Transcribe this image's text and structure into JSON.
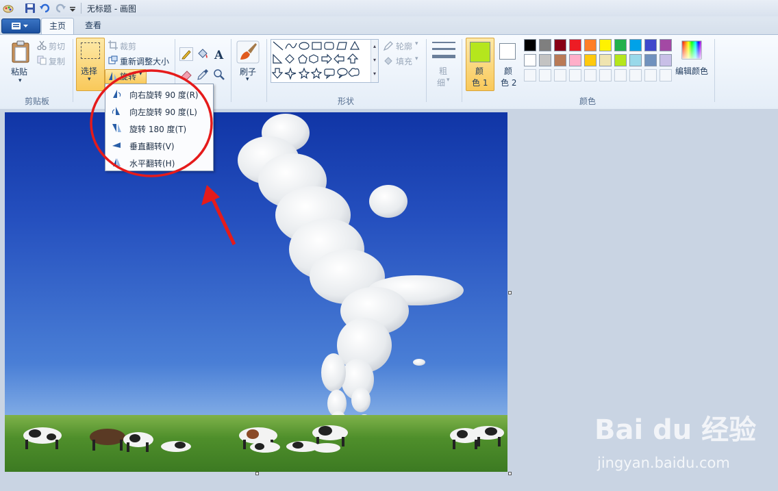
{
  "window": {
    "title": "无标题 - 画图"
  },
  "tabs": [
    {
      "label": "主页"
    },
    {
      "label": "查看"
    }
  ],
  "clipboard": {
    "paste": "粘贴",
    "cut": "剪切",
    "copy": "复制",
    "group": "剪贴板"
  },
  "image": {
    "select": "选择",
    "crop": "裁剪",
    "resize": "重新调整大小",
    "rotate": "旋转"
  },
  "tools": {
    "brush": "刷子"
  },
  "shapes": {
    "outline": "轮廓",
    "fill": "填充",
    "group": "形状"
  },
  "size": {
    "label_line1": "粗",
    "label_line2": "细"
  },
  "colors": {
    "color1_line1": "颜",
    "color1_line2": "色 1",
    "color2_line1": "颜",
    "color2_line2": "色 2",
    "edit": "编辑颜色",
    "group": "颜色",
    "color1_value": "#b5e61d",
    "color2_value": "#ffffff",
    "palette": [
      "#000000",
      "#7f7f7f",
      "#880015",
      "#ed1c24",
      "#ff7f27",
      "#fff200",
      "#22b14c",
      "#00a2e8",
      "#3f48cc",
      "#a349a4",
      "#ffffff",
      "#c3c3c3",
      "#b97a57",
      "#ffaec9",
      "#ffc90e",
      "#efe4b0",
      "#b5e61d",
      "#99d9ea",
      "#7092be",
      "#c8bfe7"
    ]
  },
  "rotate_menu": [
    {
      "label": "向右旋转 90 度(R)",
      "icon": "rotate-right-icon"
    },
    {
      "label": "向左旋转 90 度(L)",
      "icon": "rotate-left-icon"
    },
    {
      "label": "旋转 180 度(T)",
      "icon": "rotate-180-icon"
    },
    {
      "label": "垂直翻转(V)",
      "icon": "flip-vertical-icon"
    },
    {
      "label": "水平翻转(H)",
      "icon": "flip-horizontal-icon"
    }
  ],
  "watermark": {
    "logo": "Bai du 经验",
    "url": "jingyan.baidu.com"
  }
}
